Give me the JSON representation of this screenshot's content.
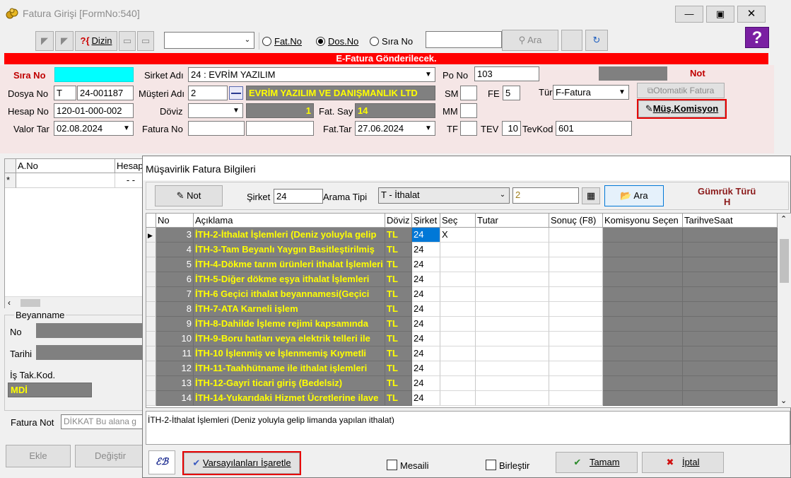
{
  "window": {
    "title": "Fatura Girişi [FormNo:540]"
  },
  "toolbar": {
    "dizin_label": "Dizin",
    "radios": [
      {
        "label": "Fat.No",
        "selected": false
      },
      {
        "label": "Dos.No",
        "selected": true
      },
      {
        "label": "Sıra No",
        "selected": false
      }
    ],
    "ara_label": "Ara"
  },
  "banner": "E-Fatura Gönderilecek.",
  "form": {
    "sira_no_label": "Sıra No",
    "sirket_adi_label": "Sirket Adı",
    "sirket_adi_value": "24 : EVRİM YAZILIM",
    "po_no_label": "Po No",
    "po_no_value": "103",
    "not_label": "Not",
    "dosya_no_label": "Dosya No",
    "dosya_no_prefix": "T",
    "dosya_no_value": "24-001187",
    "musteri_adi_label": "Müşteri Adı",
    "musteri_code": "2",
    "musteri_name": "EVRİM YAZILIM VE DANIŞMANLIK LTD",
    "sm_label": "SM",
    "fe_label": "FE",
    "fe_value": "5",
    "tur_label": "Tür",
    "tur_value": "F-Fatura",
    "otomatik_fatura_label": "Otomatik Fatura",
    "hesap_no_label": "Hesap No",
    "hesap_no_value": "120-01-000-002",
    "doviz_label": "Döviz",
    "doviz_count": "1",
    "fat_say_label": "Fat. Say",
    "fat_say_value": "14",
    "mm_label": "MM",
    "mus_komisyon_label": "Müş.Komisyon",
    "valor_tar_label": "Valor Tar",
    "valor_tar_value": "02.08.2024",
    "fatura_no_label": "Fatura No",
    "fat_tar_label": "Fat.Tar",
    "fat_tar_value": "27.06.2024",
    "tf_label": "TF",
    "tev_label": "TEV",
    "tev_value": "10",
    "tevkod_label": "TevKod",
    "tevkod_value": "601"
  },
  "left_grid": {
    "headers": [
      "A.No",
      "Hesap"
    ],
    "row_marker": "*",
    "row_value": "- -"
  },
  "beyanname": {
    "group_label": "Beyanname",
    "no_label": "No",
    "tarihi_label": "Tarihi",
    "is_tak_kod_label": "İş Tak.Kod.",
    "is_tak_kod_value": "MDİ",
    "fatura_not_label": "Fatura Not",
    "fatura_not_value": "DİKKAT Bu alana g",
    "ekle_label": "Ekle",
    "degistir_label": "Değiştir"
  },
  "dialog": {
    "title": "Müşavirlik Fatura Bilgileri",
    "not_button": "Not",
    "sirket_label": "Şirket",
    "sirket_value": "24",
    "arama_tipi_label": "Arama Tipi",
    "arama_tipi_value": "T - İthalat",
    "arama_code": "2",
    "ara_button": "Ara",
    "gumruk_turu_label": "Gümrük Türü",
    "gumruk_turu_value": "H",
    "columns": [
      "No",
      "Açıklama",
      "Döviz",
      "Şirket",
      "Seç",
      "Tutar",
      "Sonuç (F8)",
      "Komisyonu Seçen",
      "TarihveSaat"
    ],
    "rows": [
      {
        "no": "3",
        "aciklama": "İTH-2-İthalat İşlemleri (Deniz yoluyla gelip",
        "doviz": "TL",
        "sirket": "24",
        "sec": "X"
      },
      {
        "no": "4",
        "aciklama": "İTH-3-Tam Beyanlı Yaygın Basitleştirilmiş",
        "doviz": "TL",
        "sirket": "24",
        "sec": ""
      },
      {
        "no": "5",
        "aciklama": "İTH-4-Dökme tarım ürünleri ithalat İşlemleri",
        "doviz": "TL",
        "sirket": "24",
        "sec": ""
      },
      {
        "no": "6",
        "aciklama": "İTH-5-Diğer dökme eşya ithalat İşlemleri",
        "doviz": "TL",
        "sirket": "24",
        "sec": ""
      },
      {
        "no": "7",
        "aciklama": "İTH-6 Geçici ithalat beyannamesi(Geçici",
        "doviz": "TL",
        "sirket": "24",
        "sec": ""
      },
      {
        "no": "8",
        "aciklama": "İTH-7-ATA Karneli işlem",
        "doviz": "TL",
        "sirket": "24",
        "sec": ""
      },
      {
        "no": "9",
        "aciklama": "İTH-8-Dahilde İşleme rejimi kapsamında",
        "doviz": "TL",
        "sirket": "24",
        "sec": ""
      },
      {
        "no": "10",
        "aciklama": "İTH-9-Boru hatları veya elektrik telleri ile",
        "doviz": "TL",
        "sirket": "24",
        "sec": ""
      },
      {
        "no": "11",
        "aciklama": "İTH-10 İşlenmiş ve İşlenmemiş Kıymetli",
        "doviz": "TL",
        "sirket": "24",
        "sec": ""
      },
      {
        "no": "12",
        "aciklama": "İTH-11-Taahhütname ile ithalat işlemleri",
        "doviz": "TL",
        "sirket": "24",
        "sec": ""
      },
      {
        "no": "13",
        "aciklama": "İTH-12-Gayri ticari giriş (Bedelsiz)",
        "doviz": "TL",
        "sirket": "24",
        "sec": ""
      },
      {
        "no": "14",
        "aciklama": "İTH-14-Yukarıdaki Hizmet Ücretlerine ilave",
        "doviz": "TL",
        "sirket": "24",
        "sec": ""
      }
    ],
    "description": "İTH-2-İthalat İşlemleri (Deniz yoluyla gelip limanda yapılan ithalat)",
    "varsayilanlari_label": "Varsayılanları İşaretle",
    "mesaili_label": "Mesaili",
    "birlestir_label": "Birleştir",
    "tamam_label": "Tamam",
    "iptal_label": "İptal"
  }
}
